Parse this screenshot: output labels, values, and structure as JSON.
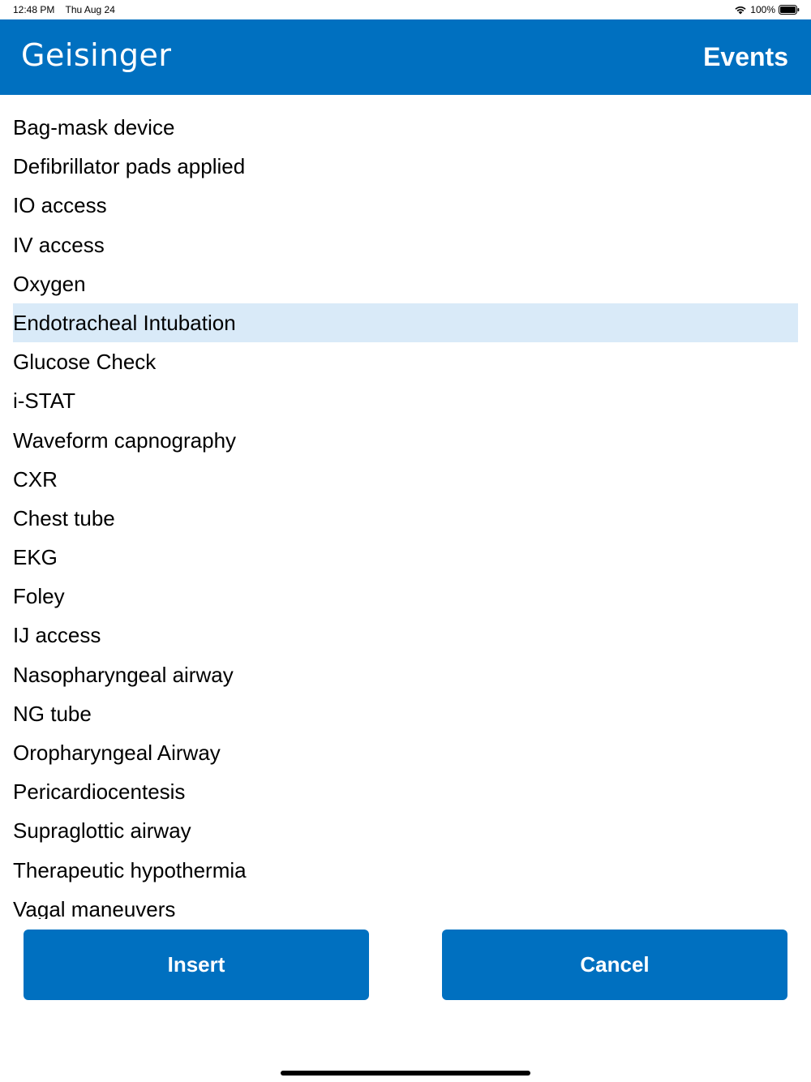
{
  "status_bar": {
    "time": "12:48 PM",
    "date": "Thu Aug 24",
    "battery": "100%"
  },
  "header": {
    "logo": "Geisinger",
    "title": "Events",
    "color": "#0070c0"
  },
  "events": [
    {
      "label": "Bag-mask device",
      "selected": false
    },
    {
      "label": "Defibrillator pads applied",
      "selected": false
    },
    {
      "label": "IO access",
      "selected": false
    },
    {
      "label": "IV access",
      "selected": false
    },
    {
      "label": "Oxygen",
      "selected": false
    },
    {
      "label": "Endotracheal Intubation",
      "selected": true
    },
    {
      "label": "Glucose Check",
      "selected": false
    },
    {
      "label": "i-STAT",
      "selected": false
    },
    {
      "label": "Waveform capnography",
      "selected": false
    },
    {
      "label": "CXR",
      "selected": false
    },
    {
      "label": "Chest tube",
      "selected": false
    },
    {
      "label": "EKG",
      "selected": false
    },
    {
      "label": "Foley",
      "selected": false
    },
    {
      "label": "IJ access",
      "selected": false
    },
    {
      "label": "Nasopharyngeal airway",
      "selected": false
    },
    {
      "label": "NG tube",
      "selected": false
    },
    {
      "label": "Oropharyngeal Airway",
      "selected": false
    },
    {
      "label": "Pericardiocentesis",
      "selected": false
    },
    {
      "label": "Supraglottic airway",
      "selected": false
    },
    {
      "label": "Therapeutic hypothermia",
      "selected": false
    },
    {
      "label": "Vagal maneuvers",
      "selected": false
    }
  ],
  "buttons": {
    "insert": "Insert",
    "cancel": "Cancel"
  },
  "icons": {
    "wifi": "wifi-icon",
    "battery": "battery-icon"
  },
  "colors": {
    "accent": "#0070c0",
    "selected_row": "#d9eaf8"
  }
}
